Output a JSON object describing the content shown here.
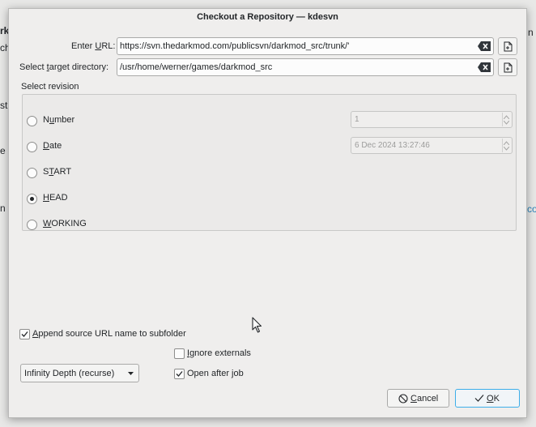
{
  "background": {
    "peek_texts": [
      "rk",
      "ch",
      "sti",
      "e",
      "n"
    ],
    "peek_right": [
      "n",
      "co"
    ]
  },
  "dialog": {
    "title": "Checkout a Repository — kdesvn",
    "url": {
      "label_pre": "Enter ",
      "label_mn": "U",
      "label_post": "RL:",
      "value": "https://svn.thedarkmod.com/publicsvn/darkmod_src/trunk/'"
    },
    "target": {
      "label_pre": "Select ",
      "label_mn": "t",
      "label_post": "arget directory:",
      "value": "/usr/home/werner/games/darkmod_src"
    },
    "revision": {
      "group_label": "Select revision",
      "options": [
        {
          "pre": "N",
          "mn": "u",
          "post": "mber",
          "checked": false
        },
        {
          "pre": "",
          "mn": "D",
          "post": "ate",
          "checked": false
        },
        {
          "pre": "S",
          "mn": "T",
          "post": "ART",
          "checked": false
        },
        {
          "pre": "",
          "mn": "H",
          "post": "EAD",
          "checked": true
        },
        {
          "pre": "",
          "mn": "W",
          "post": "ORKING",
          "checked": false
        }
      ],
      "number_value": "1",
      "date_value": "6 Dec 2024 13:27:46"
    },
    "append_subfolder": {
      "pre": "",
      "mn": "A",
      "post": "ppend source URL name to subfolder",
      "checked": true
    },
    "ignore_externals": {
      "pre": "",
      "mn": "I",
      "post": "gnore externals",
      "checked": false
    },
    "open_after_job": {
      "pre": "Open after ",
      "mn": "j",
      "post": "ob",
      "checked": true
    },
    "depth": {
      "selected": "Infinity Depth (recurse)"
    },
    "buttons": {
      "cancel": {
        "pre": "",
        "mn": "C",
        "post": "ancel"
      },
      "ok": {
        "pre": "",
        "mn": "O",
        "post": "K"
      }
    }
  }
}
